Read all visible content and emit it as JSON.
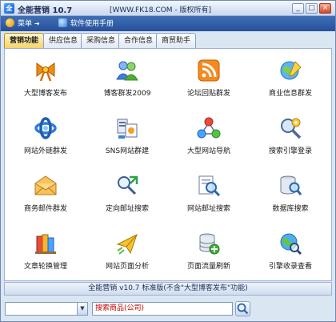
{
  "window": {
    "title": "全能营销 10.7",
    "site_text": "[WWW.FK18.COM - 版权所有]",
    "controls": {
      "minimize": "_",
      "maximize": "□",
      "close": "×"
    }
  },
  "menu": {
    "main_label": "菜单",
    "manual_label": "软件使用手册"
  },
  "tabs": [
    {
      "label": "营销功能",
      "active": true
    },
    {
      "label": "供应信息",
      "active": false
    },
    {
      "label": "采购信息",
      "active": false
    },
    {
      "label": "合作信息",
      "active": false
    },
    {
      "label": "商贸助手",
      "active": false
    }
  ],
  "tools": [
    {
      "label": "大型博客发布",
      "icon": "blog-bow-icon"
    },
    {
      "label": "博客群发2009",
      "icon": "users-group-icon"
    },
    {
      "label": "论坛回贴群发",
      "icon": "rss-feed-icon"
    },
    {
      "label": "商业信息群发",
      "icon": "globe-pen-icon"
    },
    {
      "label": "网站外链群发",
      "icon": "link-knot-icon"
    },
    {
      "label": "SNS网站群建",
      "icon": "sns-network-icon"
    },
    {
      "label": "大型网站导航",
      "icon": "network-nodes-icon"
    },
    {
      "label": "搜索引擎登录",
      "icon": "search-engine-gear-icon"
    },
    {
      "label": "商务邮件群发",
      "icon": "envelope-icon"
    },
    {
      "label": "定向邮址搜索",
      "icon": "directed-search-icon"
    },
    {
      "label": "网站邮址搜索",
      "icon": "document-magnifier-icon"
    },
    {
      "label": "数据库搜索",
      "icon": "database-magnifier-icon"
    },
    {
      "label": "文章轮换管理",
      "icon": "books-icon"
    },
    {
      "label": "网站页面分析",
      "icon": "paper-plane-icon"
    },
    {
      "label": "页面流量刷新",
      "icon": "server-refresh-icon"
    },
    {
      "label": "引擎收录查看",
      "icon": "globe-magnifier-icon"
    }
  ],
  "status_text": "全能营销 v10.7 标准版(不含\"大型博客发布\"功能)",
  "bottom": {
    "combo_value": "",
    "search_text": "搜索商品(公司)"
  }
}
